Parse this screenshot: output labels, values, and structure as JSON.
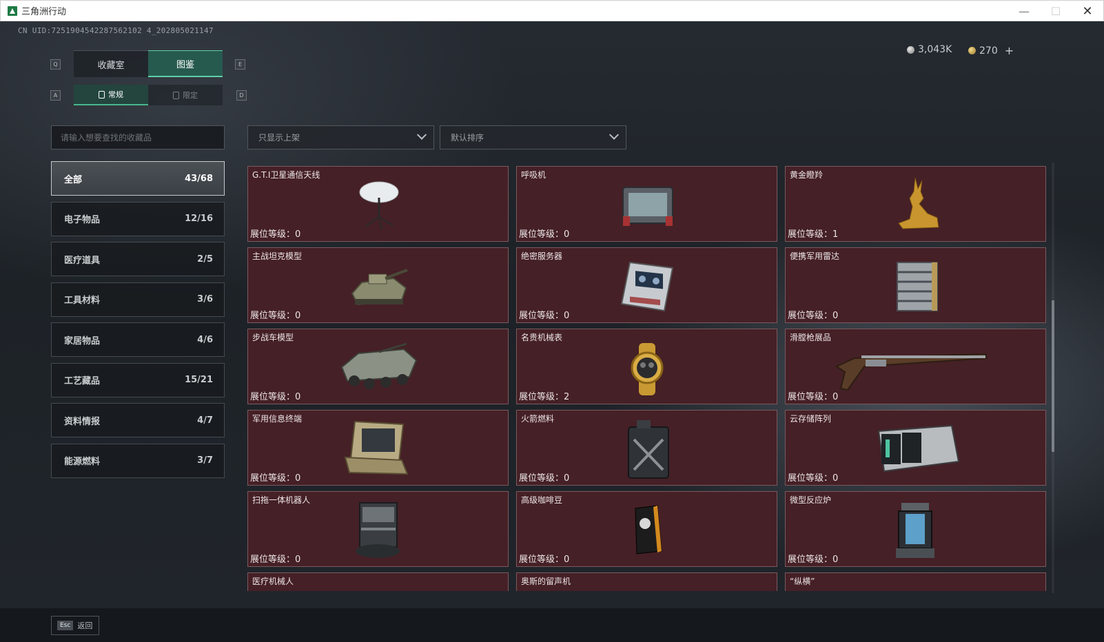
{
  "window": {
    "title": "三角洲行动",
    "minimize": "—",
    "maximize": "☐",
    "close": "✕"
  },
  "uid": "CN UID:7251904542287562102 4_202805021147",
  "currency": {
    "silver": "3,043K",
    "gold": "270",
    "plus": "+"
  },
  "keys": {
    "prev_tab": "Q",
    "next_tab": "E",
    "prev_sub": "A",
    "next_sub": "D"
  },
  "tabs": [
    {
      "label": "收藏室",
      "active": false
    },
    {
      "label": "图鉴",
      "active": true
    }
  ],
  "subtabs": [
    {
      "label": "常规",
      "active": true
    },
    {
      "label": "限定",
      "active": false
    }
  ],
  "search": {
    "placeholder": "请输入想要查找的收藏品"
  },
  "filters": {
    "shelf_filter": "只显示上架",
    "sort": "默认排序"
  },
  "categories": [
    {
      "name": "全部",
      "count": "43/68",
      "active": true
    },
    {
      "name": "电子物品",
      "count": "12/16"
    },
    {
      "name": "医疗道具",
      "count": "2/5"
    },
    {
      "name": "工具材料",
      "count": "3/6"
    },
    {
      "name": "家居物品",
      "count": "4/6"
    },
    {
      "name": "工艺藏品",
      "count": "15/21"
    },
    {
      "name": "资料情报",
      "count": "4/7"
    },
    {
      "name": "能源燃料",
      "count": "3/7"
    }
  ],
  "level_label": "展位等级：",
  "items": [
    {
      "name": "G.T.I卫星通信天线",
      "level": "0",
      "icon": "satellite-dish-icon"
    },
    {
      "name": "呼吸机",
      "level": "0",
      "icon": "ventilator-icon"
    },
    {
      "name": "黄金瞪羚",
      "level": "1",
      "icon": "golden-gazelle-icon"
    },
    {
      "name": "主战坦克模型",
      "level": "0",
      "icon": "tank-model-icon"
    },
    {
      "name": "绝密服务器",
      "level": "0",
      "icon": "server-icon"
    },
    {
      "name": "便携军用雷达",
      "level": "0",
      "icon": "radar-icon"
    },
    {
      "name": "步战车模型",
      "level": "0",
      "icon": "ifv-model-icon"
    },
    {
      "name": "名贵机械表",
      "level": "2",
      "icon": "watch-icon"
    },
    {
      "name": "滑膛枪展品",
      "level": "0",
      "icon": "musket-icon"
    },
    {
      "name": "军用信息终端",
      "level": "0",
      "icon": "terminal-icon"
    },
    {
      "name": "火箭燃料",
      "level": "0",
      "icon": "fuel-can-icon"
    },
    {
      "name": "云存储阵列",
      "level": "0",
      "icon": "storage-array-icon"
    },
    {
      "name": "扫拖一体机器人",
      "level": "0",
      "icon": "robot-vacuum-icon"
    },
    {
      "name": "高级咖啡豆",
      "level": "0",
      "icon": "coffee-bag-icon"
    },
    {
      "name": "微型反应炉",
      "level": "0",
      "icon": "reactor-icon"
    },
    {
      "name": "医疗机械人",
      "level": "",
      "icon": ""
    },
    {
      "name": "奥斯的留声机",
      "level": "",
      "icon": ""
    },
    {
      "name": "“纵横”",
      "level": "",
      "icon": ""
    }
  ],
  "footer": {
    "esc_key": "Esc",
    "back_label": "返回"
  }
}
